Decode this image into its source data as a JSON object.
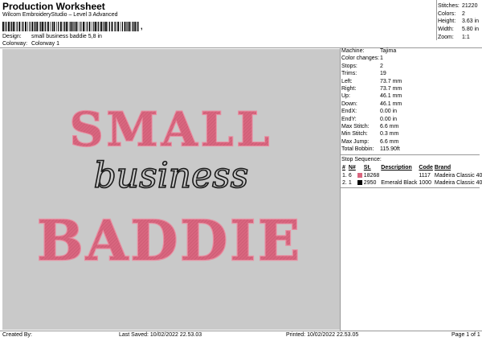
{
  "header": {
    "title": "Production Worksheet",
    "software": "Wilcom EmbroideryStudio – Level 3 Advanced",
    "barcode_char": ","
  },
  "design_meta": {
    "design_label": "Design:",
    "design_value": "small business baddie 5,8 in",
    "colorway_label": "Colorway:",
    "colorway_value": "Colorway 1"
  },
  "stats": [
    {
      "label": "Stitches:",
      "value": "21220"
    },
    {
      "label": "Colors:",
      "value": "2"
    },
    {
      "label": "Height:",
      "value": "3.63 in"
    },
    {
      "label": "Width:",
      "value": "5.80 in"
    },
    {
      "label": "Zoom:",
      "value": "1:1"
    }
  ],
  "machine_info": [
    {
      "label": "Machine:",
      "value": "Tajima"
    },
    {
      "label": "Color changes:",
      "value": "1"
    },
    {
      "label": "Stops:",
      "value": "2"
    },
    {
      "label": "Trims:",
      "value": "19"
    },
    {
      "label": "Left:",
      "value": "73.7 mm"
    },
    {
      "label": "Right:",
      "value": "73.7 mm"
    },
    {
      "label": "Up:",
      "value": "46.1 mm"
    },
    {
      "label": "Down:",
      "value": "46.1 mm"
    },
    {
      "label": "EndX:",
      "value": "0.00 in"
    },
    {
      "label": "EndY:",
      "value": "0.00 in"
    },
    {
      "label": "Max Stitch:",
      "value": "6.6 mm"
    },
    {
      "label": "Min Stitch:",
      "value": "0.3 mm"
    },
    {
      "label": "Max Jump:",
      "value": "6.6 mm"
    },
    {
      "label": "Total Bobbin:",
      "value": "115.90ft"
    }
  ],
  "stop_sequence": {
    "title": "Stop Sequence:",
    "headers": [
      "#",
      "N#",
      "",
      "St.",
      "Description",
      "Code",
      "Brand"
    ],
    "rows": [
      {
        "num": "1.",
        "n": "6",
        "color": "#d9667f",
        "st": "18268",
        "desc": "",
        "code": "1117",
        "brand": "Madeira Classic 40"
      },
      {
        "num": "2.",
        "n": "1",
        "color": "#000000",
        "st": "2950",
        "desc": "Emerald Black",
        "code": "1000",
        "brand": "Madeira Classic 40"
      }
    ]
  },
  "design": {
    "line1": "SMALL",
    "line2": "business",
    "line3": "BADDIE",
    "fill_color": "#d9667f",
    "outline_color": "#e88fa2",
    "script_color": "#1a1a1a",
    "background": "#c9c9c9"
  },
  "footer": {
    "created_by": "Created By:",
    "last_saved": "Last Saved: 10/02/2022 22.53.03",
    "printed": "Printed: 10/02/2022 22.53.05",
    "page": "Page 1 of 1"
  }
}
